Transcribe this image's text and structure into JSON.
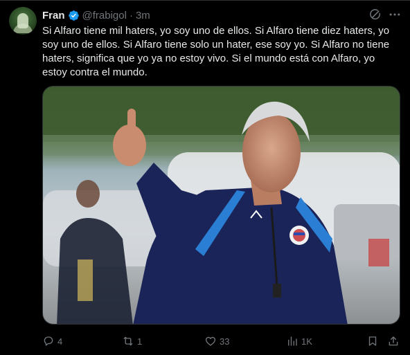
{
  "post": {
    "author_name": "Fran",
    "handle": "@frabigol",
    "separator": "·",
    "time": "3m",
    "text": "Si Alfaro tiene mil haters, yo soy uno de ellos. Si Alfaro tiene diez haters, yo soy uno de ellos. Si Alfaro tiene solo un hater, ese soy yo. Si Alfaro no tiene haters, significa que yo ya no estoy vivo. Si el mundo está con Alfaro, yo estoy contra el mundo."
  },
  "actions": {
    "replies": "4",
    "reposts": "1",
    "likes": "33",
    "views": "1K"
  },
  "icons": {
    "avatar": "avatar",
    "verified": "verified-badge-icon",
    "grok": "grok-icon",
    "more": "more-options-icon",
    "reply": "reply-icon",
    "repost": "repost-icon",
    "like": "heart-icon",
    "views": "views-chart-icon",
    "bookmark": "bookmark-icon",
    "share": "share-icon"
  },
  "colors": {
    "background": "#000000",
    "text": "#e7e9ea",
    "muted": "#71767b",
    "verified": "#1d9bf0",
    "border": "#2f3336"
  }
}
